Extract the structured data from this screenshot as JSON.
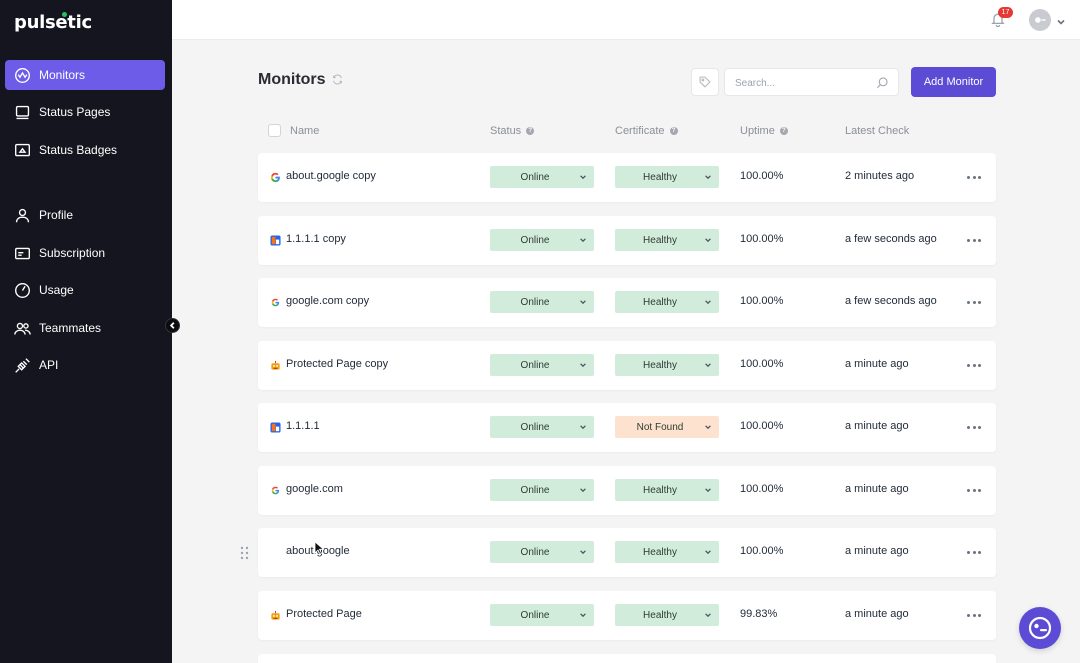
{
  "app": {
    "logo": "pulsetic"
  },
  "sidebar": {
    "items": [
      {
        "label": "Monitors",
        "icon": "monitors-icon",
        "active": true
      },
      {
        "label": "Status Pages",
        "icon": "status-pages-icon"
      },
      {
        "label": "Status Badges",
        "icon": "status-badges-icon"
      },
      {
        "label": "Profile",
        "icon": "profile-icon"
      },
      {
        "label": "Subscription",
        "icon": "subscription-icon"
      },
      {
        "label": "Usage",
        "icon": "usage-icon"
      },
      {
        "label": "Teammates",
        "icon": "teammates-icon"
      },
      {
        "label": "API",
        "icon": "api-icon"
      }
    ]
  },
  "topbar": {
    "notification_count": "17"
  },
  "main": {
    "title": "Monitors",
    "search": {
      "placeholder": "Search...",
      "value": ""
    },
    "add_button": "Add Monitor",
    "columns": {
      "name": "Name",
      "status": "Status",
      "certificate": "Certificate",
      "uptime": "Uptime",
      "latest": "Latest Check"
    },
    "rows": [
      {
        "name": "about.google copy",
        "favicon": "google",
        "status": "Online",
        "certificate": "Healthy",
        "uptime": "100.00%",
        "latest": "2 minutes ago"
      },
      {
        "name": "1.1.1.1 copy",
        "favicon": "cloudflare",
        "status": "Online",
        "certificate": "Healthy",
        "uptime": "100.00%",
        "latest": "a few seconds ago"
      },
      {
        "name": "google.com copy",
        "favicon": "google",
        "status": "Online",
        "certificate": "Healthy",
        "uptime": "100.00%",
        "latest": "a few seconds ago"
      },
      {
        "name": "Protected Page copy",
        "favicon": "robot",
        "status": "Online",
        "certificate": "Healthy",
        "uptime": "100.00%",
        "latest": "a minute ago"
      },
      {
        "name": "1.1.1.1",
        "favicon": "cloudflare",
        "status": "Online",
        "certificate": "Not Found",
        "uptime": "100.00%",
        "latest": "a minute ago"
      },
      {
        "name": "google.com",
        "favicon": "google",
        "status": "Online",
        "certificate": "Healthy",
        "uptime": "100.00%",
        "latest": "a minute ago"
      },
      {
        "name": "about.google",
        "favicon": "none",
        "status": "Online",
        "certificate": "Healthy",
        "uptime": "100.00%",
        "latest": "a minute ago"
      },
      {
        "name": "Protected Page",
        "favicon": "robot",
        "status": "Online",
        "certificate": "Healthy",
        "uptime": "99.83%",
        "latest": "a minute ago"
      }
    ]
  },
  "colors": {
    "accent": "#5b4bd5",
    "sidebar": "#15151f",
    "healthy": "#d2ecdc",
    "warning": "#fde3cf"
  }
}
